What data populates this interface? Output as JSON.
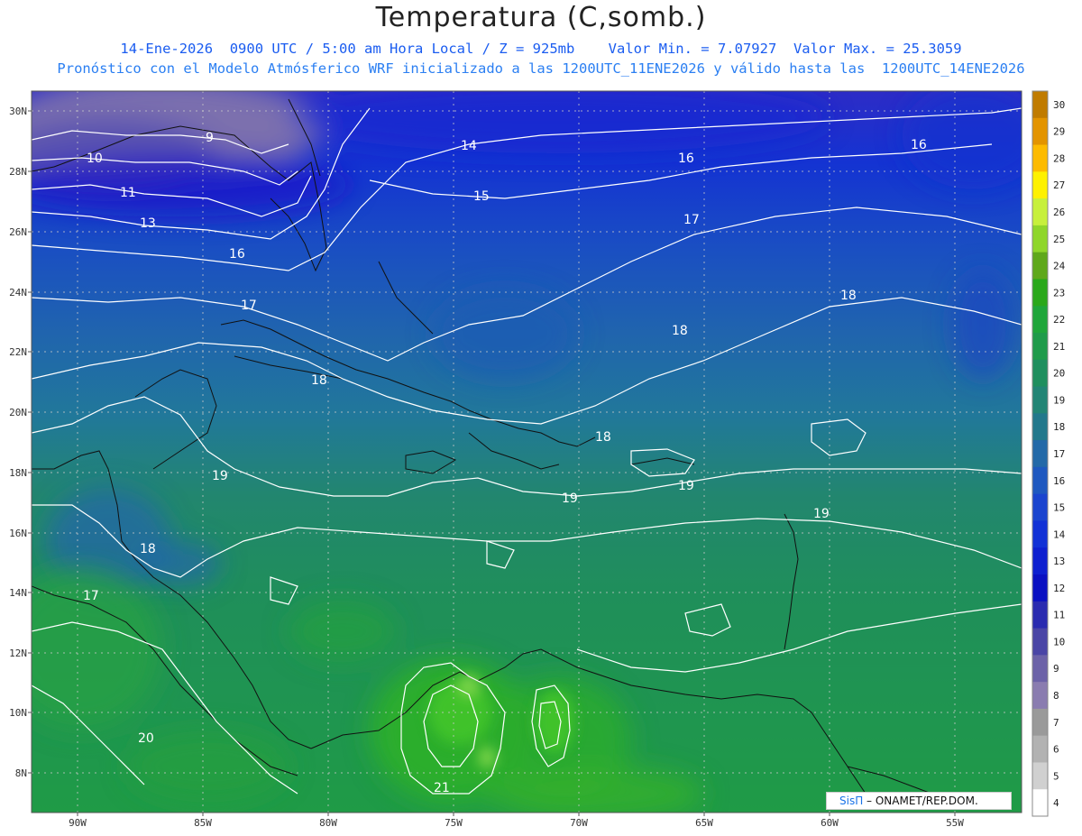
{
  "header": {
    "title": "Temperatura (C,somb.)",
    "line2": "14-Ene-2026  0900 UTC / 5:00 am Hora Local / Z = 925mb    Valor Min. = 7.07927  Valor Max. = 25.3059",
    "line3": "Pronóstico con el Modelo Atmósferico WRF inicializado a las 1200UTC_11ENE2026 y válido hasta las  1200UTC_14ENE2026"
  },
  "map": {
    "lat_ticks": [
      "30N",
      "28N",
      "26N",
      "24N",
      "22N",
      "20N",
      "18N",
      "16N",
      "14N",
      "12N",
      "10N",
      "8N"
    ],
    "lon_ticks": [
      "90W",
      "85W",
      "80W",
      "75W",
      "70W",
      "65W",
      "60W",
      "55W"
    ],
    "contour_labels": [
      "9",
      "10",
      "11",
      "13",
      "14",
      "15",
      "16",
      "16",
      "16",
      "17",
      "17",
      "17",
      "18",
      "18",
      "18",
      "18",
      "18",
      "19",
      "19",
      "19",
      "19",
      "20",
      "21"
    ]
  },
  "colorbar": {
    "labels": [
      "30",
      "29",
      "28",
      "27",
      "26",
      "25",
      "24",
      "23",
      "22",
      "21",
      "20",
      "19",
      "18",
      "17",
      "16",
      "15",
      "14",
      "13",
      "12",
      "11",
      "10",
      "9",
      "8",
      "7",
      "6",
      "5",
      "4"
    ],
    "colors": [
      "#c07b00",
      "#e39400",
      "#fdbb00",
      "#fef100",
      "#c7f03c",
      "#8fd62a",
      "#5fa81a",
      "#2aa81a",
      "#1fa63a",
      "#1f9b4a",
      "#1f8f5e",
      "#228575",
      "#22788c",
      "#2369a8",
      "#1e58c0",
      "#1a44cf",
      "#1131d6",
      "#0d1fd0",
      "#0a10c2",
      "#2a2bb0",
      "#4a45a6",
      "#6c62a8",
      "#8a7cb0",
      "#9a9a9a",
      "#b2b2b2",
      "#d0d0d0",
      "#ffffff"
    ]
  },
  "credit": {
    "brand": "SisΠ",
    "text": " – ONAMET/REP.DOM."
  }
}
